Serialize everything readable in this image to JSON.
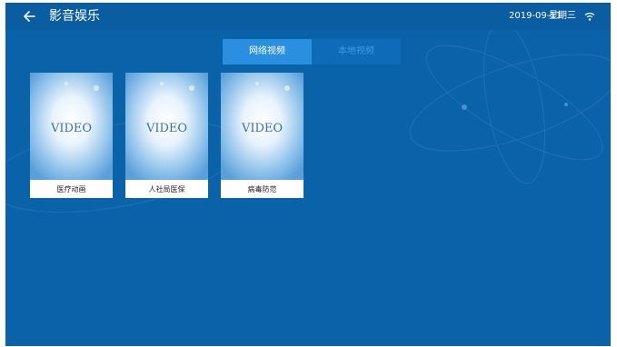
{
  "header": {
    "title": "影音娱乐",
    "date": "2019-09-11",
    "weekday": "星期三"
  },
  "tabs": [
    {
      "label": "网络视频",
      "active": true
    },
    {
      "label": "本地视频",
      "active": false
    }
  ],
  "videos": [
    {
      "thumb_text": "VIDEO",
      "label": "医疗动画"
    },
    {
      "thumb_text": "VIDEO",
      "label": "人社局医保"
    },
    {
      "thumb_text": "VIDEO",
      "label": "病毒防范"
    }
  ],
  "colors": {
    "background": "#0a62a8",
    "topbar": "#0a5da0",
    "tab_active": "#2a8fe0",
    "tab_inactive_text": "#3d9de6"
  },
  "icons": {
    "back": "arrow-left-icon",
    "wifi": "wifi-icon"
  }
}
